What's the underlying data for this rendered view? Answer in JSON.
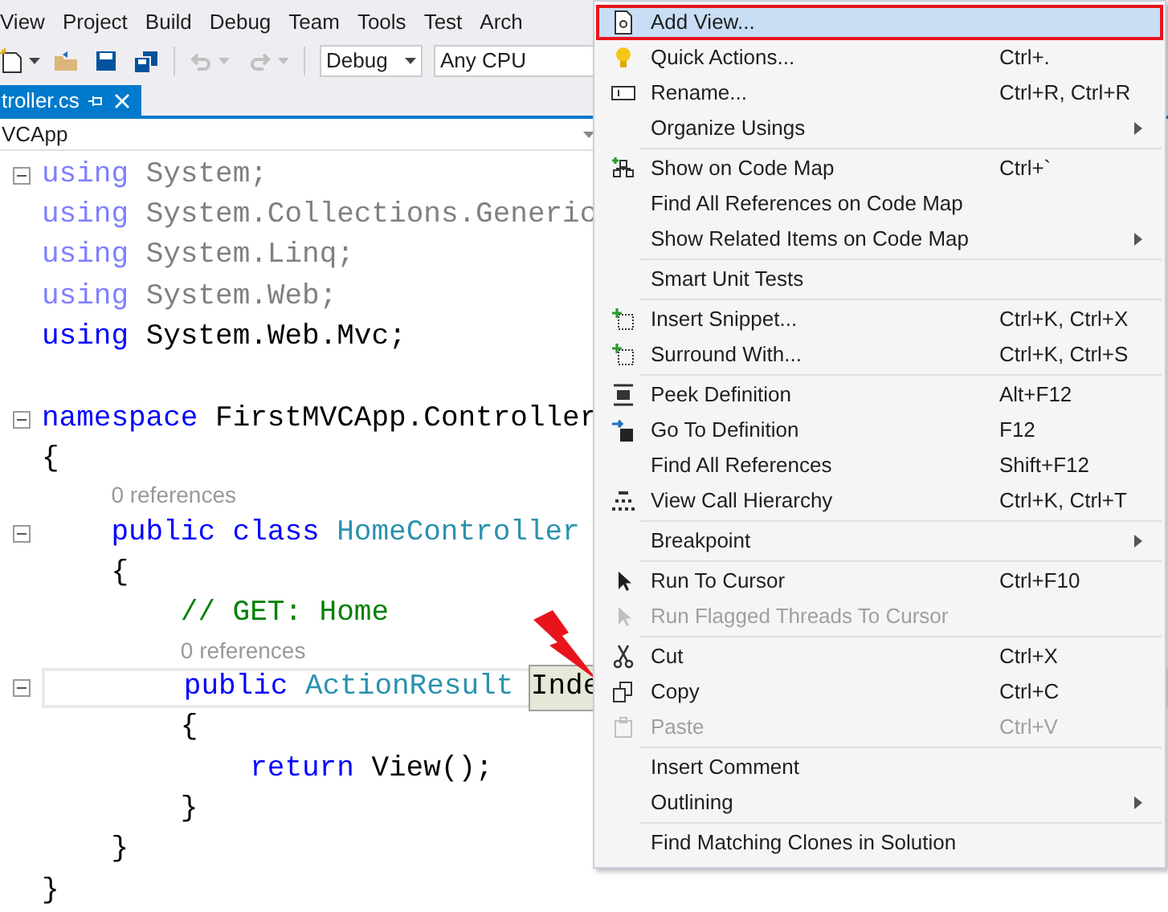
{
  "menu_bar": [
    "View",
    "Project",
    "Build",
    "Debug",
    "Team",
    "Tools",
    "Test",
    "Arch"
  ],
  "toolbar": {
    "configuration": "Debug",
    "platform": "Any CPU",
    "undo_disabled": true,
    "redo_disabled": true
  },
  "document_tab": {
    "label": "troller.cs",
    "selected": true
  },
  "navigation_bar": {
    "project": "VCApp"
  },
  "code": {
    "lines": [
      {
        "kind": "code",
        "collapse": true,
        "tokens": [
          {
            "kind": "keyword-faded",
            "text": "using"
          },
          {
            "kind": "faded",
            "text": "System;"
          }
        ]
      },
      {
        "kind": "code",
        "collapse": false,
        "tokens": [
          {
            "kind": "keyword-faded",
            "text": "using"
          },
          {
            "kind": "faded",
            "text": "System.Collections.Generic"
          }
        ]
      },
      {
        "kind": "code",
        "collapse": false,
        "tokens": [
          {
            "kind": "keyword-faded",
            "text": "using"
          },
          {
            "kind": "faded",
            "text": "System.Linq;"
          }
        ]
      },
      {
        "kind": "code",
        "collapse": false,
        "tokens": [
          {
            "kind": "keyword-faded",
            "text": "using"
          },
          {
            "kind": "faded",
            "text": "System.Web;"
          }
        ]
      },
      {
        "kind": "code",
        "collapse": false,
        "tokens": [
          {
            "kind": "keyword",
            "text": "using"
          },
          {
            "kind": "plain",
            "text": "System.Web.Mvc;"
          }
        ]
      },
      {
        "kind": "blank"
      },
      {
        "kind": "code",
        "collapse": true,
        "tokens": [
          {
            "kind": "keyword",
            "text": "namespace"
          },
          {
            "kind": "plain",
            "text": "FirstMVCApp.Controller"
          }
        ]
      },
      {
        "kind": "code",
        "collapse": false,
        "tokens": [
          {
            "kind": "plain",
            "text": "{"
          }
        ]
      },
      {
        "kind": "block",
        "children": [
          {
            "kind": "codelens",
            "text": "0 references"
          },
          {
            "kind": "code",
            "collapse": true,
            "tokens": [
              {
                "kind": "keyword",
                "text": "public class"
              },
              {
                "kind": "type",
                "text": "HomeController"
              }
            ]
          },
          {
            "kind": "code",
            "collapse": false,
            "tokens": [
              {
                "kind": "plain",
                "text": "{"
              }
            ]
          },
          {
            "kind": "block",
            "children": [
              {
                "kind": "code",
                "collapse": false,
                "tokens": [
                  {
                    "kind": "comment",
                    "text": "// GET: Home"
                  }
                ]
              },
              {
                "kind": "codelens",
                "text": "0 references"
              },
              {
                "kind": "code",
                "collapse": true,
                "current": true,
                "tokens": [
                  {
                    "kind": "keyword",
                    "text": "public"
                  },
                  {
                    "kind": "type",
                    "text": "ActionResult"
                  },
                  {
                    "kind": "highlight",
                    "text": "Inde"
                  }
                ]
              },
              {
                "kind": "code",
                "collapse": false,
                "tokens": [
                  {
                    "kind": "plain",
                    "text": "{"
                  }
                ]
              },
              {
                "kind": "block",
                "children": [
                  {
                    "kind": "code",
                    "collapse": false,
                    "tokens": [
                      {
                        "kind": "keyword",
                        "text": "return"
                      },
                      {
                        "kind": "plain",
                        "text": "View();"
                      }
                    ]
                  }
                ]
              },
              {
                "kind": "code",
                "collapse": false,
                "tokens": [
                  {
                    "kind": "plain",
                    "text": "}"
                  }
                ]
              }
            ]
          },
          {
            "kind": "code",
            "collapse": false,
            "tokens": [
              {
                "kind": "plain",
                "text": "}"
              }
            ]
          }
        ]
      },
      {
        "kind": "code",
        "collapse": false,
        "tokens": [
          {
            "kind": "plain",
            "text": "}"
          }
        ]
      }
    ]
  },
  "context_menu": [
    {
      "kind": "item",
      "label": "Add View...",
      "selected": true,
      "disabled": false,
      "submenu": false
    },
    {
      "kind": "item",
      "label": "Quick Actions...",
      "shortcut": "Ctrl+.",
      "selected": false,
      "disabled": false,
      "submenu": false
    },
    {
      "kind": "item",
      "label": "Rename...",
      "shortcut": "Ctrl+R, Ctrl+R",
      "selected": false,
      "disabled": false,
      "submenu": false
    },
    {
      "kind": "item",
      "label": "Organize Usings",
      "selected": false,
      "disabled": false,
      "submenu": true
    },
    {
      "kind": "separator"
    },
    {
      "kind": "item",
      "label": "Show on Code Map",
      "shortcut": "Ctrl+`",
      "selected": false,
      "disabled": false,
      "submenu": false
    },
    {
      "kind": "item",
      "label": "Find All References on Code Map",
      "selected": false,
      "disabled": false,
      "submenu": false
    },
    {
      "kind": "item",
      "label": "Show Related Items on Code Map",
      "selected": false,
      "disabled": false,
      "submenu": true
    },
    {
      "kind": "separator"
    },
    {
      "kind": "item",
      "label": "Smart Unit Tests",
      "selected": false,
      "disabled": false,
      "submenu": false
    },
    {
      "kind": "separator"
    },
    {
      "kind": "item",
      "label": "Insert Snippet...",
      "shortcut": "Ctrl+K, Ctrl+X",
      "selected": false,
      "disabled": false,
      "submenu": false
    },
    {
      "kind": "item",
      "label": "Surround With...",
      "shortcut": "Ctrl+K, Ctrl+S",
      "selected": false,
      "disabled": false,
      "submenu": false
    },
    {
      "kind": "separator"
    },
    {
      "kind": "item",
      "label": "Peek Definition",
      "shortcut": "Alt+F12",
      "selected": false,
      "disabled": false,
      "submenu": false
    },
    {
      "kind": "item",
      "label": "Go To Definition",
      "shortcut": "F12",
      "selected": false,
      "disabled": false,
      "submenu": false
    },
    {
      "kind": "item",
      "label": "Find All References",
      "shortcut": "Shift+F12",
      "selected": false,
      "disabled": false,
      "submenu": false
    },
    {
      "kind": "item",
      "label": "View Call Hierarchy",
      "shortcut": "Ctrl+K, Ctrl+T",
      "selected": false,
      "disabled": false,
      "submenu": false
    },
    {
      "kind": "separator"
    },
    {
      "kind": "item",
      "label": "Breakpoint",
      "selected": false,
      "disabled": false,
      "submenu": true
    },
    {
      "kind": "separator"
    },
    {
      "kind": "item",
      "label": "Run To Cursor",
      "shortcut": "Ctrl+F10",
      "selected": false,
      "disabled": false,
      "submenu": false
    },
    {
      "kind": "item",
      "label": "Run Flagged Threads To Cursor",
      "selected": false,
      "disabled": true,
      "submenu": false
    },
    {
      "kind": "separator"
    },
    {
      "kind": "item",
      "label": "Cut",
      "shortcut": "Ctrl+X",
      "selected": false,
      "disabled": false,
      "submenu": false
    },
    {
      "kind": "item",
      "label": "Copy",
      "shortcut": "Ctrl+C",
      "selected": false,
      "disabled": false,
      "submenu": false
    },
    {
      "kind": "item",
      "label": "Paste",
      "shortcut": "Ctrl+V",
      "selected": false,
      "disabled": true,
      "submenu": false
    },
    {
      "kind": "separator"
    },
    {
      "kind": "item",
      "label": "Insert Comment",
      "selected": false,
      "disabled": false,
      "submenu": false
    },
    {
      "kind": "item",
      "label": "Outlining",
      "selected": false,
      "disabled": false,
      "submenu": true
    },
    {
      "kind": "separator"
    },
    {
      "kind": "item",
      "label": "Find Matching Clones in Solution",
      "selected": false,
      "disabled": false,
      "submenu": false
    }
  ]
}
